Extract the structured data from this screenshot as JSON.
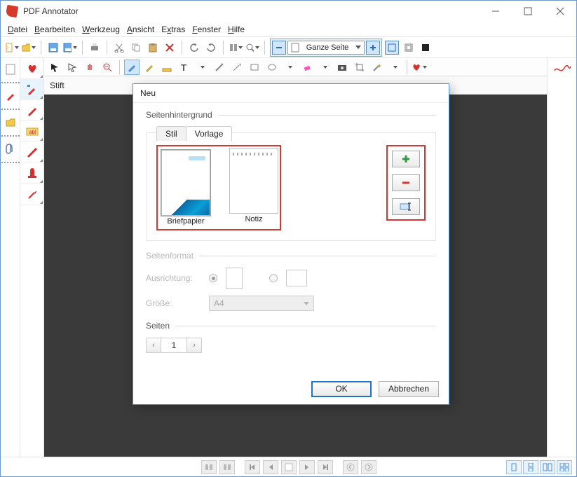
{
  "app": {
    "title": "PDF Annotator"
  },
  "menu": {
    "file": "Datei",
    "edit": "Bearbeiten",
    "tool": "Werkzeug",
    "view": "Ansicht",
    "extra": "Extras",
    "window": "Fenster",
    "help": "Hilfe"
  },
  "toolbar": {
    "zoom_label": "Ganze Seite"
  },
  "tooltabs": {
    "pen_label": "Stift"
  },
  "dialog": {
    "title": "Neu",
    "section_bg": "Seitenhintergrund",
    "tab_style": "Stil",
    "tab_template": "Vorlage",
    "templates": [
      {
        "caption": "Briefpapier",
        "selected": true,
        "kind": "brief"
      },
      {
        "caption": "Notiz",
        "selected": false,
        "kind": "notiz"
      }
    ],
    "section_format": "Seitenformat",
    "orientation_label": "Ausrichtung:",
    "size_label": "Größe:",
    "size_value": "A4",
    "section_pages": "Seiten",
    "page_count": "1",
    "ok": "OK",
    "cancel": "Abbrechen"
  }
}
